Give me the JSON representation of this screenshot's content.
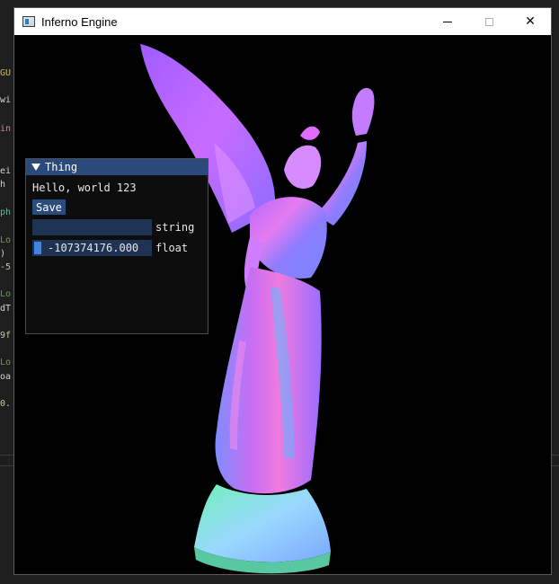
{
  "background_editor": {
    "lines": [
      {
        "text": "GU",
        "color": "#d4b85c"
      },
      {
        "text": "wi",
        "color": "#d4d4d4"
      },
      {
        "text": "in",
        "color": "#d47fa0"
      },
      {
        "text": "ei",
        "color": "#d4d4d4"
      },
      {
        "text": " h",
        "color": "#d4d4d4"
      },
      {
        "text": "ph",
        "color": "#4fc1a0"
      },
      {
        "text": "Lo",
        "color": "#6a9955"
      },
      {
        "text": ")",
        "color": "#d4d4d4"
      },
      {
        "text": "-5",
        "color": "#b5cea8"
      },
      {
        "text": "Lo",
        "color": "#6a9955"
      },
      {
        "text": "dT",
        "color": "#d4d4d4"
      },
      {
        "text": "9f",
        "color": "#b5cea8"
      },
      {
        "text": "Lo",
        "color": "#6a9955"
      },
      {
        "text": "oa",
        "color": "#d4d4d4"
      },
      {
        "text": "0.",
        "color": "#b5cea8"
      }
    ]
  },
  "window": {
    "title": "Inferno Engine",
    "minimize_label": "",
    "maximize_label": "",
    "close_label": "✕"
  },
  "imgui_panel": {
    "title": "Thing",
    "hello_text": "Hello, world 123",
    "save_label": "Save",
    "string_field": {
      "value": "",
      "label": "string"
    },
    "float_slider": {
      "value": "-107374176.000",
      "label": "float"
    }
  },
  "colors": {
    "panel_title_bg": "#294a7a",
    "button_bg": "#2a4c7d",
    "frame_bg": "#1f3352",
    "slider_grab": "#3d85e0"
  }
}
